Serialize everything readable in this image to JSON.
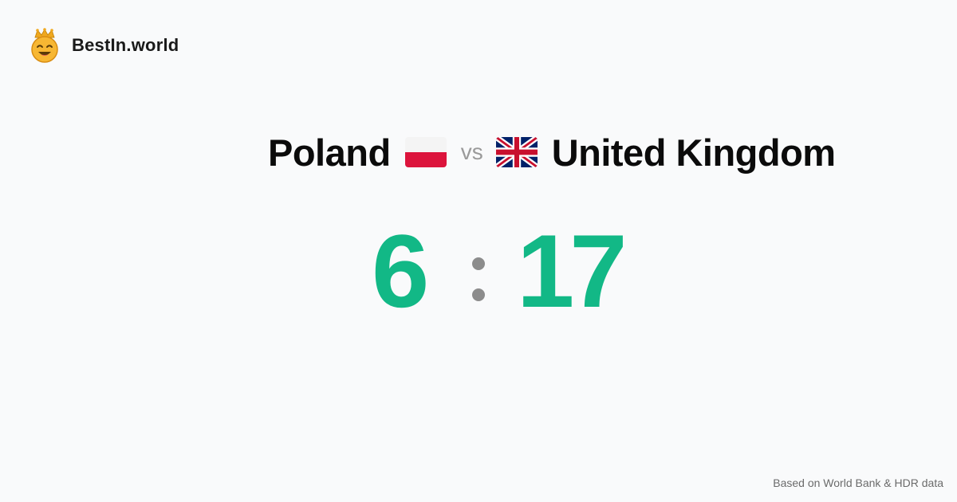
{
  "brand": {
    "name": "BestIn.world",
    "logo_icon": "crown-smiley-icon"
  },
  "matchup": {
    "left_country": "Poland",
    "left_flag_icon": "poland-flag-icon",
    "vs_label": "vs",
    "right_country": "United Kingdom",
    "right_flag_icon": "uk-flag-icon"
  },
  "score": {
    "left": "6",
    "right": "17",
    "separator": ":",
    "color": "#12b886"
  },
  "footer": {
    "source_note": "Based on World Bank & HDR data"
  }
}
